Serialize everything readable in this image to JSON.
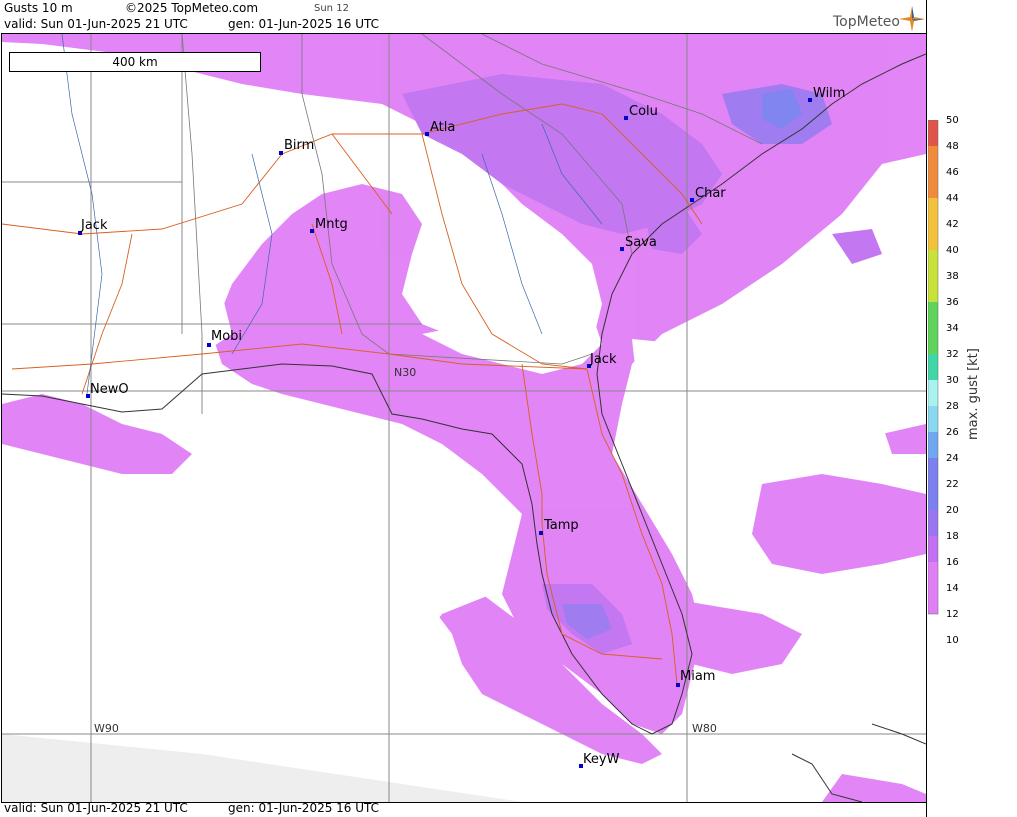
{
  "header": {
    "product": "Gusts 10 m",
    "copyright": "©2025 TopMeteo.com",
    "day": "Sun 12",
    "valid": "valid:  Sun  01-Jun-2025  21 UTC",
    "gen": "gen: 01-Jun-2025 16 UTC"
  },
  "logo": {
    "text": "TopMeteo",
    "icon": "compass-star-icon"
  },
  "scale": {
    "label": "400 km"
  },
  "cities": [
    {
      "name": "Birm"
    },
    {
      "name": "Atla"
    },
    {
      "name": "Colu"
    },
    {
      "name": "Wilm"
    },
    {
      "name": "Char"
    },
    {
      "name": "Sava"
    },
    {
      "name": "Jack"
    },
    {
      "name": "Mntg"
    },
    {
      "name": "Mobi"
    },
    {
      "name": "NewO"
    },
    {
      "name": "Jack"
    },
    {
      "name": "Tamp"
    },
    {
      "name": "Miam"
    },
    {
      "name": "KeyW"
    }
  ],
  "grid_labels": {
    "lat": "N30",
    "lon1": "W90",
    "lon2": "W80"
  },
  "legend": {
    "title": "max. gust  [kt]",
    "ticks": [
      "50",
      "48",
      "46",
      "44",
      "42",
      "40",
      "38",
      "36",
      "34",
      "32",
      "30",
      "28",
      "26",
      "24",
      "22",
      "20",
      "18",
      "16",
      "14",
      "12",
      "10"
    ],
    "colors": {
      "c50": "#e0554a",
      "c46": "#f08a3c",
      "c42": "#f4c23a",
      "c38": "#c9e23a",
      "c34": "#5fd35a",
      "c30": "#3fd6a8",
      "c28": "#aaf2f0",
      "c26": "#88d8f0",
      "c24": "#6fa8f0",
      "c20": "#7b7ff0",
      "c18": "#9a75f0",
      "c16": "#c070f0",
      "c12": "#e07ef5"
    }
  },
  "footer": {
    "valid": "valid:  Sun  01-Jun-2025  21 UTC",
    "gen": "gen: 01-Jun-2025 16 UTC"
  }
}
